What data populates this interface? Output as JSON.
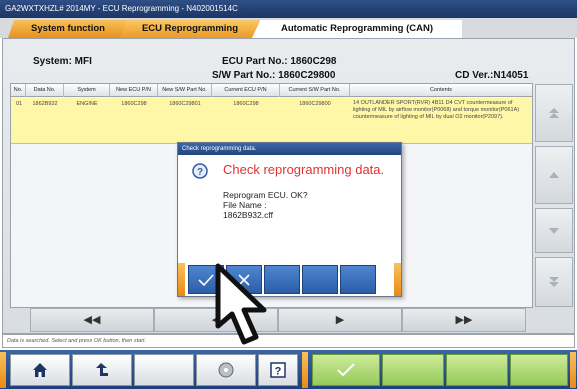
{
  "window": {
    "title": "GA2WXTXHZL# 2014MY   -   ECU Reprogramming   -   N402001514C"
  },
  "tabs": [
    {
      "label": "System function"
    },
    {
      "label": "ECU Reprogramming"
    },
    {
      "label": "Automatic Reprogramming (CAN)"
    }
  ],
  "info": {
    "system": "System: MFI",
    "ecu_part": "ECU Part No.: 1860C298",
    "sw_part": "S/W Part No.: 1860C29800",
    "cd_ver": "CD Ver.:N14051"
  },
  "table": {
    "headers": [
      "No.",
      "Data No.",
      "System",
      "New ECU P/N",
      "New S/W Part No.",
      "Current ECU P/N",
      "Current S/W Part No.",
      "Contents"
    ],
    "rows": [
      {
        "no": "01",
        "data_no": "1862B932",
        "system": "ENGINE",
        "new_ecu": "1860C298",
        "new_sw": "1860C29801",
        "cur_ecu": "1860C298",
        "cur_sw": "1860C29800",
        "contents": "14 OUTLANDER SPORT(RVR) 4B11 D4 CVT countermeasure of lighting of MIL by airflow monitor(P0068) and torque monitor(P061A) countermeasure of lighting of MIL by dual O2 monitor(P2097)."
      }
    ]
  },
  "dialog": {
    "title": "Check reprogramming data.",
    "heading": "Check reprogramming data.",
    "line1": "Reprogram ECU. OK?",
    "line2": "File Name :",
    "line3": "1862B932.cff"
  },
  "status": {
    "text": "Data is searched. Select and press OK button, then start."
  },
  "nav": {
    "first": "◀◀",
    "prev": "◀",
    "next": "▶",
    "last": "▶▶"
  },
  "colors": {
    "accent_orange": "#e98a12",
    "title_blue": "#1f3f78",
    "row_highlight": "#fff7a8",
    "dialog_heading": "#e23030"
  }
}
